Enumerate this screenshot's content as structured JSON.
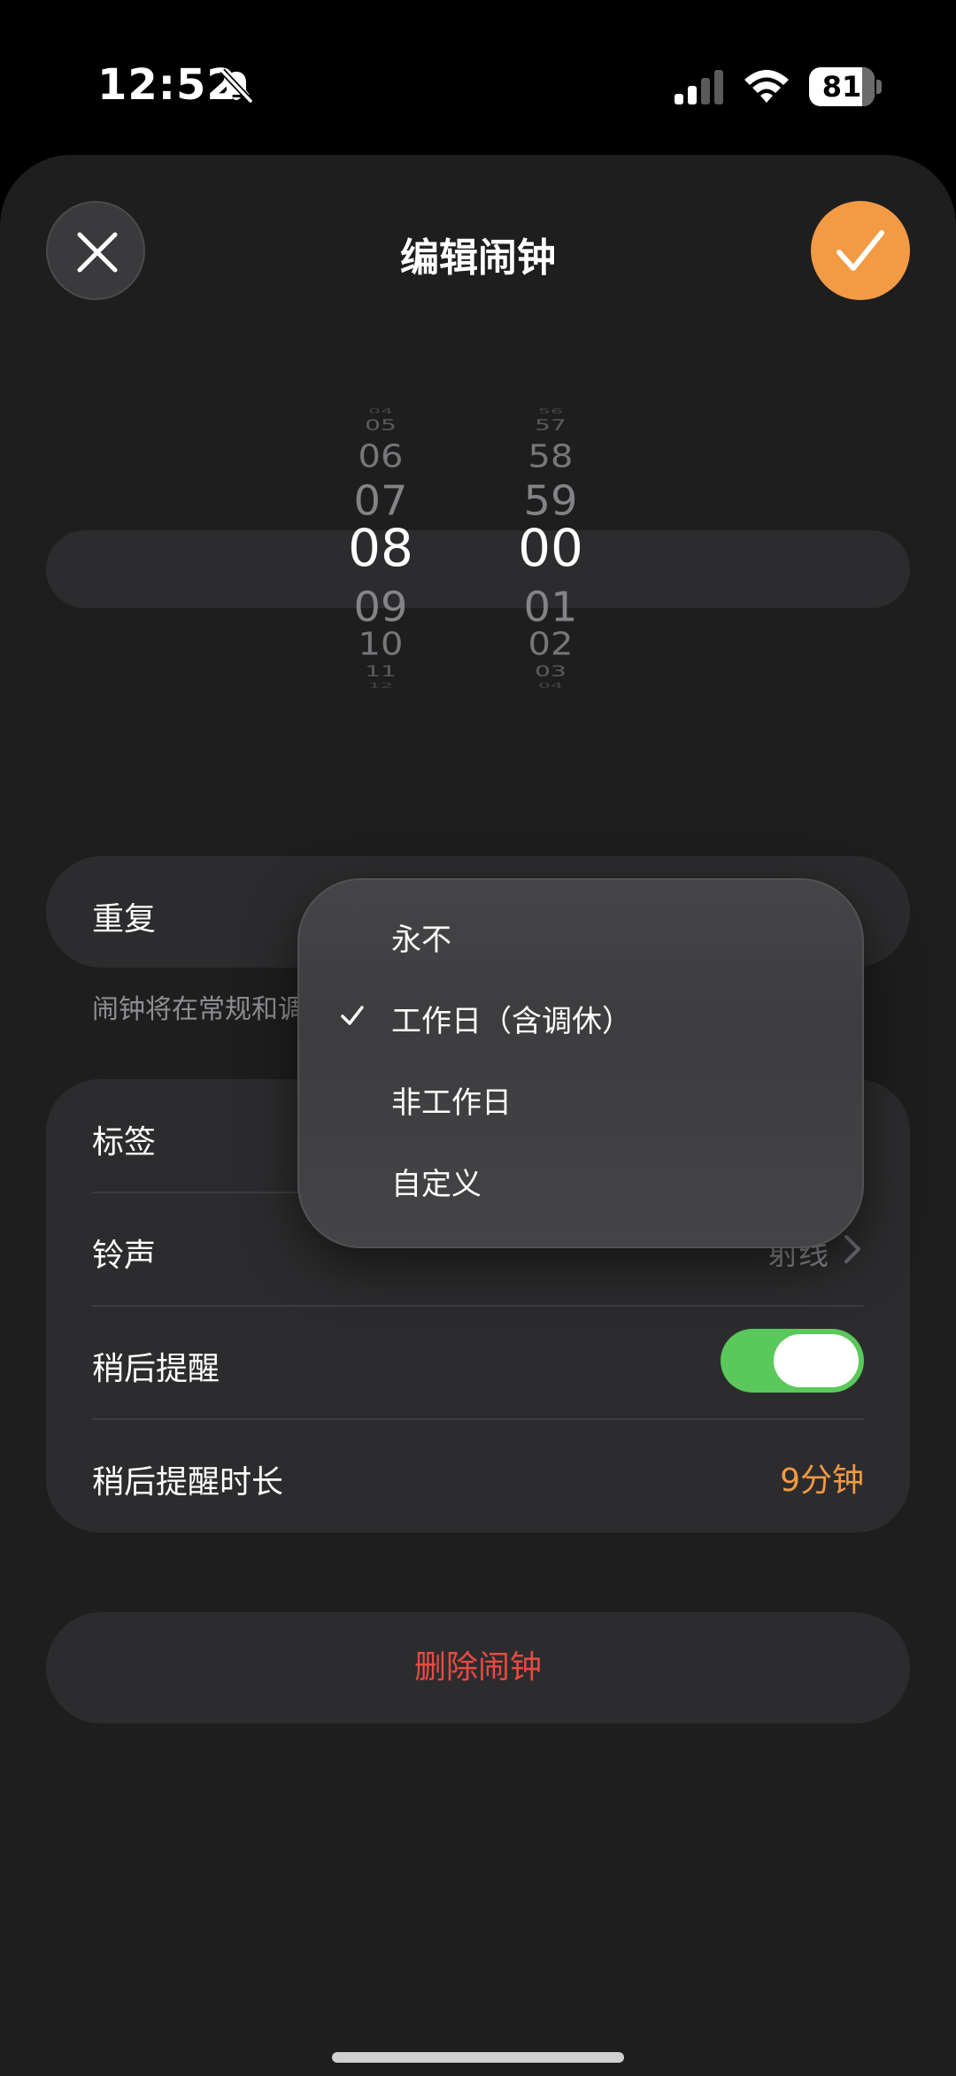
{
  "status_bar": {
    "time": "12:52",
    "battery": 81,
    "battery_text": "81"
  },
  "header": {
    "title": "编辑闹钟"
  },
  "picker": {
    "hours": [
      "04",
      "05",
      "06",
      "07",
      "08",
      "09",
      "10",
      "11",
      "12"
    ],
    "minutes": [
      "56",
      "57",
      "58",
      "59",
      "00",
      "01",
      "02",
      "03",
      "04"
    ],
    "selected_hour": "08",
    "selected_minute": "00"
  },
  "repeat": {
    "label": "重复",
    "note": "闹钟将在常规和调"
  },
  "settings": {
    "label_row": "标签",
    "ringtone_row": "铃声",
    "ringtone_value": "射线",
    "snooze_row": "稍后提醒",
    "snooze_enabled": true,
    "snooze_duration_row": "稍后提醒时长",
    "snooze_duration_value": "9分钟"
  },
  "delete": {
    "label": "删除闹钟"
  },
  "menu": {
    "items": [
      {
        "label": "永不",
        "checked": false
      },
      {
        "label": "工作日（含调休）",
        "checked": true
      },
      {
        "label": "非工作日",
        "checked": false
      },
      {
        "label": "自定义",
        "checked": false
      }
    ]
  },
  "colors": {
    "accent": "#f29a44",
    "toggle_on": "#5ac85a",
    "destructive": "#ea4a42"
  }
}
